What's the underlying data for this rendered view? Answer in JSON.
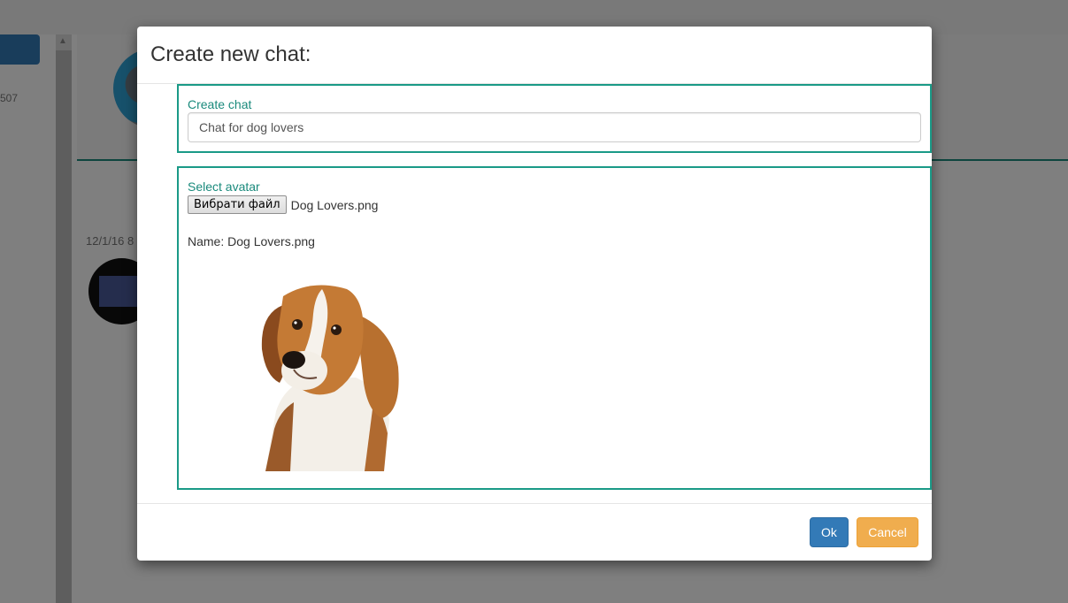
{
  "background": {
    "side_count": "507",
    "message_date": "12/1/16 8"
  },
  "modal": {
    "title": "Create new chat:",
    "chat_section": {
      "label": "Create chat",
      "input_value": "Chat for dog lovers"
    },
    "avatar_section": {
      "label": "Select avatar",
      "file_button_label": "Вибрати файл",
      "selected_file": "Dog Lovers.png",
      "name_line": "Name: Dog Lovers.png",
      "preview_icon": "beagle-dog-image"
    },
    "footer": {
      "ok_label": "Ok",
      "cancel_label": "Cancel"
    }
  },
  "colors": {
    "accent": "#1a9a87",
    "primary": "#337ab7",
    "warning": "#f0ad4e"
  }
}
